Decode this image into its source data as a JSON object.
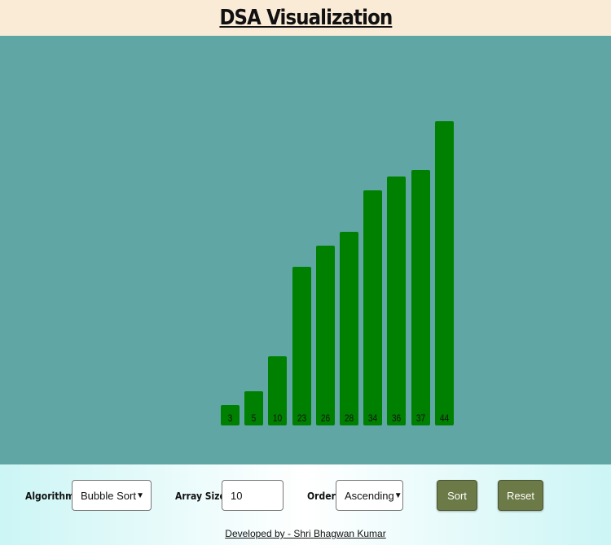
{
  "header": {
    "title": "DSA Visualization"
  },
  "chart_data": {
    "type": "bar",
    "values": [
      3,
      5,
      10,
      23,
      26,
      28,
      34,
      36,
      37,
      44
    ],
    "labels": [
      "3",
      "5",
      "10",
      "23",
      "26",
      "28",
      "34",
      "36",
      "37",
      "44"
    ],
    "bar_color": "#008000",
    "background_color": "#5fa6a5"
  },
  "controls": {
    "algorithm_label": "Algorithm:",
    "algorithm_value": "Bubble Sort",
    "array_size_label": "Array Size:",
    "array_size_value": "10",
    "order_label": "Order:",
    "order_value": "Ascending",
    "sort_button": "Sort",
    "reset_button": "Reset",
    "button_color": "#6b7a46"
  },
  "footer": {
    "credit": "Developed by - Shri Bhagwan Kumar"
  }
}
